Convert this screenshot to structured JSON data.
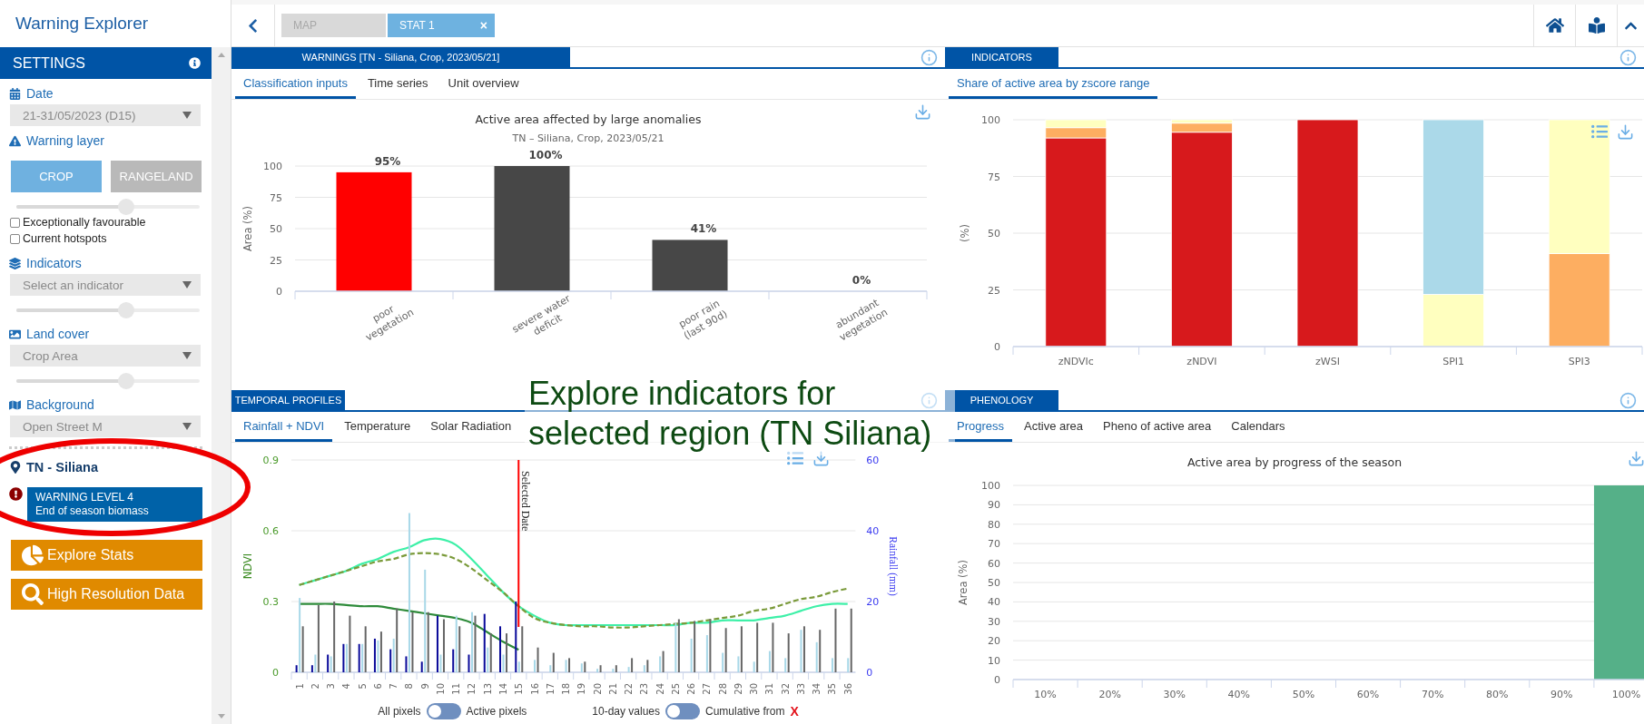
{
  "app": {
    "title": "Warning Explorer"
  },
  "settings": {
    "title": "SETTINGS",
    "date": {
      "label": "Date",
      "value": "21-31/05/2023 (D15)"
    },
    "warning_layer": {
      "label": "Warning layer",
      "buttons": [
        {
          "label": "CROP",
          "selected": true
        },
        {
          "label": "RANGELAND",
          "selected": false
        }
      ],
      "slider": {
        "level": 0.6
      },
      "checkboxes": [
        {
          "label": "Exceptionally favourable",
          "checked": false
        },
        {
          "label": "Current hotspots",
          "checked": false
        }
      ]
    },
    "indicators": {
      "label": "Indicators",
      "placeholder": "Select an indicator",
      "slider": {
        "level": 0.6
      }
    },
    "land_cover": {
      "label": "Land cover",
      "value": "Crop Area",
      "slider": {
        "level": 0.6
      }
    },
    "background": {
      "label": "Background",
      "value": "Open Street M"
    }
  },
  "region": {
    "name": "TN - Siliana",
    "warning": {
      "level": "WARNING LEVEL 4",
      "description": "End of season biomass"
    },
    "buttons": [
      {
        "label": "Explore Stats",
        "kind": "stats"
      },
      {
        "label": "High Resolution Data",
        "kind": "search"
      }
    ]
  },
  "tabs": [
    {
      "label": "MAP",
      "selected": false
    },
    {
      "label": "STAT 1",
      "selected": true,
      "close": "×"
    }
  ],
  "warnings": {
    "title": "WARNINGS [TN - Siliana, Crop, 2023/05/21]",
    "tabs": [
      {
        "label": "Classification inputs",
        "selected": true
      },
      {
        "label": "Time series",
        "selected": false
      },
      {
        "label": "Unit overview",
        "selected": false
      }
    ],
    "subtitle": "TN – Siliana, Crop, 2023/05/21",
    "chart_data": {
      "type": "bar",
      "title": "Active area affected by large anomalies",
      "ylabel": "Area (%)",
      "categories": [
        "poor\nvegetation",
        "severe water\ndeficit",
        "poor rain\n(last 90d)",
        "abundant\nvegetation"
      ],
      "ylim": [
        0,
        100
      ],
      "yticks": [
        0,
        25,
        50,
        75,
        100
      ],
      "stacked": true,
      "grid": true,
      "series": [
        {
          "color": "#ff0000",
          "values": [
            95,
            null,
            null,
            null
          ]
        },
        {
          "color": "#474747",
          "values": [
            null,
            100,
            41,
            0
          ]
        }
      ],
      "value_labels": [
        "95%",
        "100%",
        "41%",
        "0%"
      ]
    }
  },
  "indicators": {
    "title": "INDICATORS",
    "tabs": [
      {
        "label": "Share of active area by zscore range",
        "selected": true
      }
    ],
    "chart_data": {
      "type": "bar",
      "ylabel": "(%)",
      "categories": [
        "zNDVIc",
        "zNDVI",
        "zWSI",
        "SPI1",
        "SPI3"
      ],
      "ylim": [
        0,
        100
      ],
      "yticks": [
        0,
        25,
        50,
        75,
        100
      ],
      "stacked": true,
      "grid": true,
      "series": [
        {
          "color": "#d7191c",
          "values": [
            92,
            94.5,
            100,
            0,
            0
          ]
        },
        {
          "color": "#fdae61",
          "values": [
            4.5,
            4,
            0,
            0,
            41
          ]
        },
        {
          "color": "#ffffbf",
          "values": [
            3.5,
            1.5,
            0,
            23,
            59
          ]
        },
        {
          "color": "#abd9e9",
          "values": [
            0,
            0,
            0,
            77,
            0
          ]
        }
      ]
    }
  },
  "temporal": {
    "title": "TEMPORAL PROFILES",
    "tabs": [
      {
        "label": "Rainfall + NDVI",
        "selected": true
      },
      {
        "label": "Temperature",
        "selected": false
      },
      {
        "label": "Solar Radiation",
        "selected": false
      }
    ],
    "chart_data": {
      "type": "line",
      "ylabel": "NDVI",
      "categories": [
        "1",
        "2",
        "3",
        "4",
        "5",
        "6",
        "7",
        "8",
        "9",
        "10",
        "11",
        "12",
        "13",
        "14",
        "15",
        "16",
        "17",
        "18",
        "19",
        "20",
        "21",
        "22",
        "23",
        "24",
        "25",
        "26",
        "27",
        "28",
        "29",
        "30",
        "31",
        "32",
        "33",
        "34",
        "35",
        "36"
      ],
      "ylim": [
        0,
        0.9
      ],
      "yticks": [
        0,
        0.3,
        0.6,
        0.9
      ],
      "grid": true,
      "series": [
        {
          "color": "#3ef0a8",
          "line_style": "solid",
          "values": [
            0.37,
            0.39,
            0.41,
            0.43,
            0.46,
            0.48,
            0.51,
            0.53,
            0.56,
            0.565,
            0.54,
            0.48,
            0.41,
            0.34,
            0.28,
            0.24,
            0.21,
            0.2,
            0.2,
            0.2,
            0.2,
            0.2,
            0.2,
            0.2,
            0.2,
            0.21,
            0.21,
            0.22,
            0.22,
            0.22,
            0.23,
            0.24,
            0.26,
            0.28,
            0.29,
            0.29
          ]
        },
        {
          "color": "#7a9a3a",
          "line_style": "dashed",
          "values": [
            0.37,
            0.39,
            0.41,
            0.43,
            0.45,
            0.47,
            0.48,
            0.5,
            0.505,
            0.5,
            0.48,
            0.44,
            0.39,
            0.34,
            0.28,
            0.23,
            0.21,
            0.2,
            0.195,
            0.195,
            0.19,
            0.19,
            0.195,
            0.2,
            0.205,
            0.21,
            0.22,
            0.23,
            0.24,
            0.26,
            0.27,
            0.29,
            0.31,
            0.32,
            0.34,
            0.355
          ]
        },
        {
          "color": "#2e8b3a",
          "line_style": "solid",
          "values": [
            0.29,
            0.29,
            0.29,
            0.285,
            0.28,
            0.28,
            0.27,
            0.26,
            0.25,
            0.24,
            0.23,
            0.21,
            0.17,
            0.13,
            0.095,
            null,
            null,
            null,
            null,
            null,
            null,
            null,
            null,
            null,
            null,
            null,
            null,
            null,
            null,
            null,
            null,
            null,
            null,
            null,
            null,
            null
          ]
        }
      ],
      "annotations": [
        "Selected Date"
      ]
    },
    "rainfall": {
      "chart_data": {
        "type": "bar",
        "ylabel": "Rainfall (mm)",
        "ylim": [
          0,
          60
        ],
        "yticks": [
          0,
          20,
          40,
          60
        ],
        "series": [
          {
            "color": "#0a0a9a",
            "values": [
              2,
              2,
              5,
              8,
              8,
              9.5,
              6.5,
              4.5,
              3,
              16,
              6.5,
              5,
              16.5,
              13,
              20,
              null,
              null,
              null,
              null,
              null,
              null,
              null,
              null,
              null,
              null,
              null,
              null,
              null,
              null,
              null,
              null,
              null,
              null,
              null,
              null,
              null
            ]
          },
          {
            "color": "#a8d8e8",
            "values": [
              21,
              5,
              4.5,
              8,
              8,
              9,
              9.5,
              45,
              29,
              5,
              16,
              17,
              7,
              5,
              3,
              3.5,
              2,
              3.5,
              2.5,
              1,
              1,
              1.5,
              2,
              4.5,
              14,
              9.5,
              10.5,
              5.5,
              4.5,
              3,
              6,
              4,
              12,
              8.5,
              4,
              4
            ]
          },
          {
            "color": "#666666",
            "values": [
              13,
              19,
              20,
              16,
              13,
              11.5,
              18,
              17,
              17,
              15,
              13,
              16,
              11,
              11,
              13,
              7,
              5.5,
              4,
              3,
              2,
              2,
              4,
              3.5,
              6,
              15,
              14.5,
              15,
              12.5,
              13,
              14,
              14,
              11,
              13,
              12,
              18,
              18
            ]
          }
        ]
      }
    },
    "toggles": [
      {
        "off_label": "All pixels",
        "on_label": "Active pixels",
        "on": false
      },
      {
        "off_label": "10-day values",
        "on_label": "Cumulative from",
        "marker": "X",
        "on": false
      }
    ]
  },
  "phenology": {
    "title": "PHENOLOGY",
    "tabs": [
      {
        "label": "Progress",
        "selected": true
      },
      {
        "label": "Active area",
        "selected": false
      },
      {
        "label": "Pheno of active area",
        "selected": false
      },
      {
        "label": "Calendars",
        "selected": false
      }
    ],
    "chart_data": {
      "type": "bar",
      "title": "Active area by progress of the season",
      "ylabel": "Area (%)",
      "categories": [
        "10%",
        "20%",
        "30%",
        "40%",
        "50%",
        "60%",
        "70%",
        "80%",
        "90%",
        "100%"
      ],
      "ylim": [
        0,
        100
      ],
      "yticks": [
        0,
        10,
        20,
        30,
        40,
        50,
        60,
        70,
        80,
        90,
        100
      ],
      "grid": true,
      "series": [
        {
          "color": "#55b088",
          "values": [
            0,
            0,
            0,
            0,
            0,
            0,
            0,
            0,
            0,
            100
          ]
        }
      ]
    }
  },
  "annotation": {
    "text": "Explore indicators for selected region (TN Siliana)"
  }
}
